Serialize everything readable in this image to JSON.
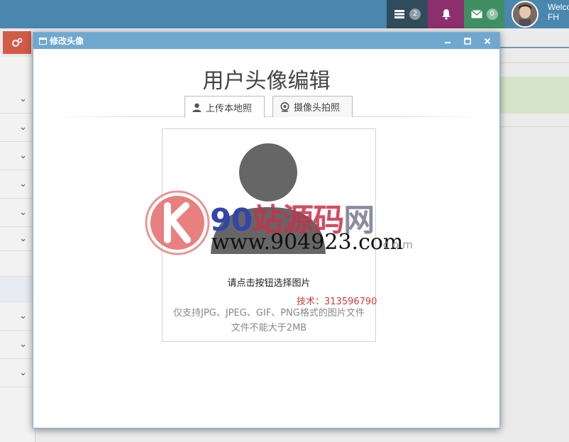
{
  "navbar": {
    "tasks_badge": "2",
    "mail_badge": "0",
    "welcome_text": "Welcome,",
    "user_name": "FH"
  },
  "modal": {
    "window_title": "修改头像",
    "editor_title": "用户头像编辑",
    "tabs": [
      {
        "label": "上传本地照",
        "icon": "user-icon",
        "active": true
      },
      {
        "label": "摄像头拍照",
        "icon": "webcam-icon",
        "active": false
      }
    ],
    "upload": {
      "prompt": "请点击按钮选择图片",
      "formats": "仅支持JPG、JPEG、GIF、PNG格式的图片文件",
      "size_limit": "文件不能大于2MB"
    }
  },
  "watermark": {
    "brand_left": "90",
    "brand_mid": "站源码",
    "brand_right": "网",
    "site": "www.904923.com",
    "domain_suffix": ".com",
    "tech": "技术：313596790"
  },
  "colors": {
    "navbar": "#4a87af",
    "tasks_box": "#2f4b5c",
    "bell_box": "#8c2f6e",
    "mail_box": "#3f8f63",
    "modal_titlebar": "#6fa8cf",
    "settings_button": "#d15b47"
  }
}
